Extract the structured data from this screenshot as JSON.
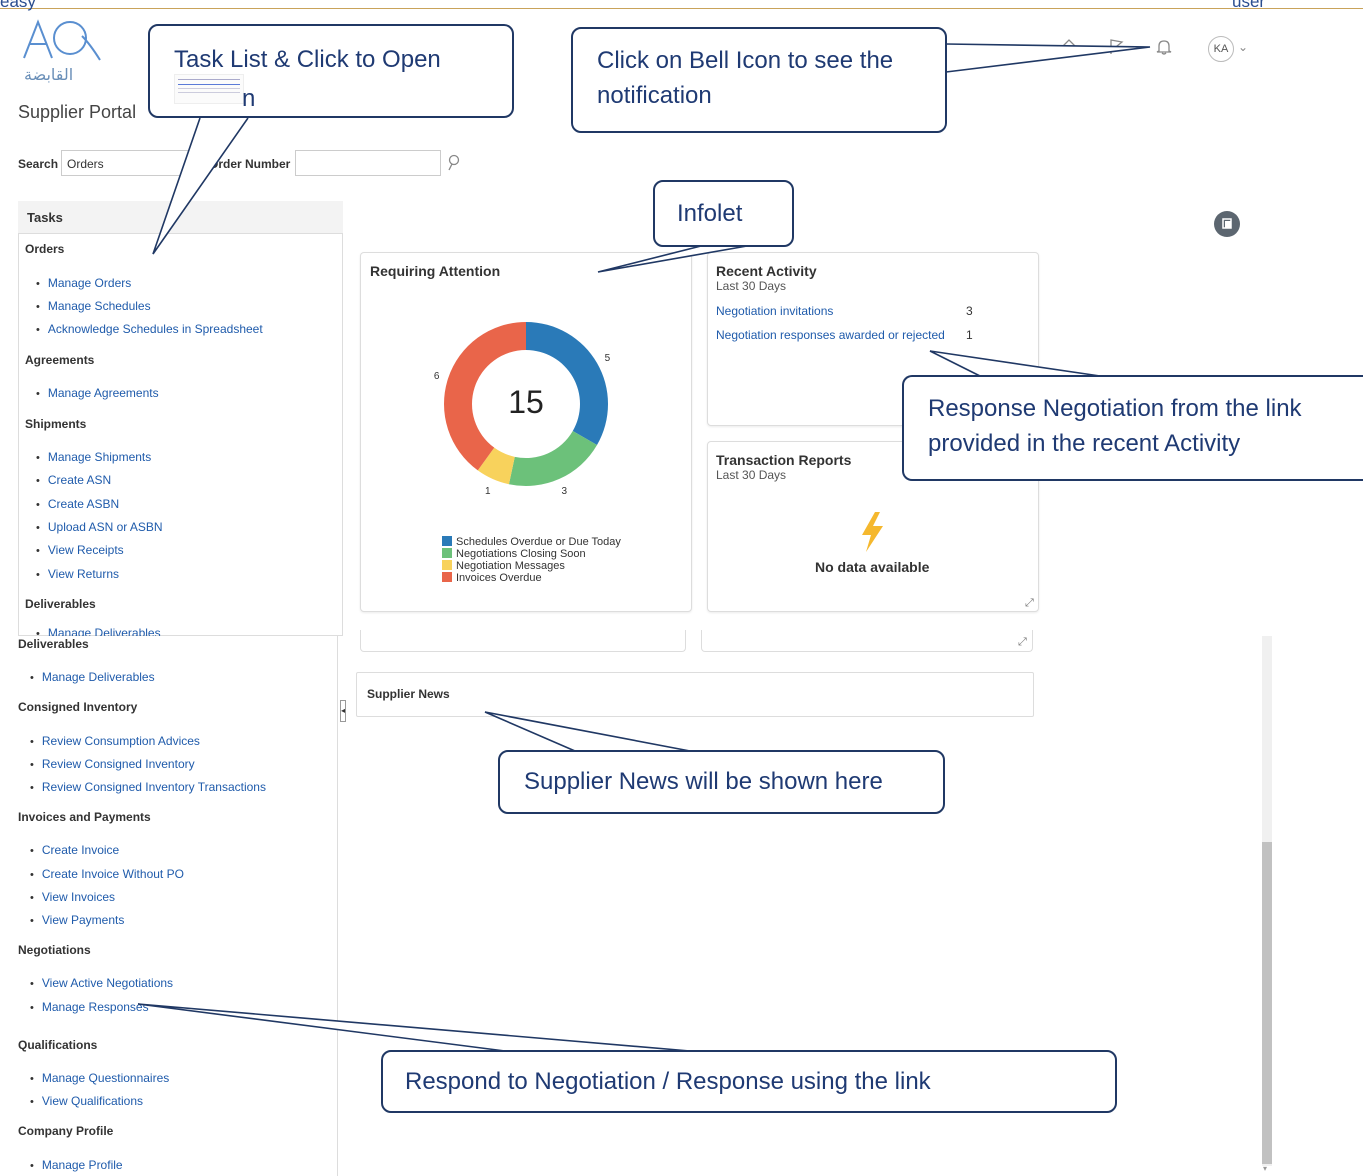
{
  "page": {
    "cut_left": "easy",
    "cut_right": "user",
    "portal_title": "Supplier Portal",
    "logo_arabic": "القابضة"
  },
  "header": {
    "avatar_initials": "KA",
    "icons": [
      "home-icon",
      "flag-icon",
      "bell-icon"
    ]
  },
  "search": {
    "label": "Search",
    "select_value": "Orders",
    "order_label": "Order Number",
    "order_value": ""
  },
  "tasks": {
    "title": "Tasks",
    "top_sections": [
      {
        "title": "Orders",
        "items": [
          "Manage Orders",
          "Manage Schedules",
          "Acknowledge Schedules in Spreadsheet"
        ]
      },
      {
        "title": "Agreements",
        "items": [
          "Manage Agreements"
        ]
      },
      {
        "title": "Shipments",
        "items": [
          "Manage Shipments",
          "Create ASN",
          "Create ASBN",
          "Upload ASN or ASBN",
          "View Receipts",
          "View Returns"
        ]
      },
      {
        "title": "Deliverables",
        "items": [
          "Manage Deliverables"
        ]
      }
    ],
    "bottom_sections": [
      {
        "title": "Deliverables",
        "items": [
          "Manage Deliverables"
        ]
      },
      {
        "title": "Consigned Inventory",
        "items": [
          "Review Consumption Advices",
          "Review Consigned Inventory",
          "Review Consigned Inventory Transactions"
        ]
      },
      {
        "title": "Invoices and Payments",
        "items": [
          "Create Invoice",
          "Create Invoice Without PO",
          "View Invoices",
          "View Payments"
        ]
      },
      {
        "title": "Negotiations",
        "items": [
          "View Active Negotiations",
          "Manage Responses"
        ]
      },
      {
        "title": "Qualifications",
        "items": [
          "Manage Questionnaires",
          "View Qualifications"
        ]
      },
      {
        "title": "Company Profile",
        "items": [
          "Manage Profile"
        ]
      }
    ]
  },
  "requiring_attention": {
    "title": "Requiring Attention",
    "total": "15"
  },
  "chart_data": {
    "type": "pie",
    "categories": [
      "Schedules Overdue or Due Today",
      "Negotiations Closing Soon",
      "Negotiation Messages",
      "Invoices Overdue"
    ],
    "values": [
      5,
      3,
      1,
      6
    ],
    "colors": [
      "#2a7ab8",
      "#6cc17a",
      "#f8d25c",
      "#e9654a"
    ],
    "title": "Requiring Attention",
    "center_label": "15"
  },
  "recent_activity": {
    "title": "Recent Activity",
    "subtitle": "Last 30 Days",
    "rows": [
      {
        "label": "Negotiation invitations",
        "count": "3"
      },
      {
        "label": "Negotiation responses awarded or rejected",
        "count": "1"
      }
    ]
  },
  "transaction_reports": {
    "title": "Transaction Reports",
    "subtitle": "Last 30 Days",
    "empty": "No data available"
  },
  "supplier_news": {
    "title": "Supplier News"
  },
  "callouts": {
    "task_list": "Task List & Click to Open",
    "task_list_overflow": "n",
    "bell": "Click on Bell Icon to see the notification",
    "infolet": "Infolet",
    "response": "Response Negotiation from the link provided in the recent Activity",
    "news": "Supplier News will be shown here",
    "respond": "Respond to Negotiation / Response using the link"
  },
  "colors": {
    "link": "#1f5bab",
    "callout_border": "#203864",
    "callout_text": "#1f3a73"
  }
}
